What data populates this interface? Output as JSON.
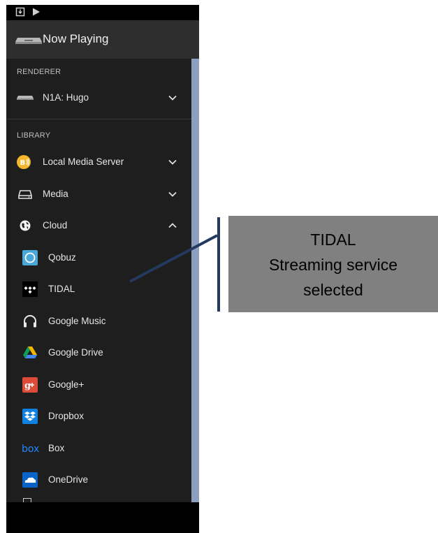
{
  "statusbar": {
    "icons": [
      "download-icon",
      "play-icon"
    ]
  },
  "appbar": {
    "title": "Now Playing",
    "icon": "streamer-device-icon"
  },
  "renderer": {
    "section_label": "RENDERER",
    "device": {
      "label": "N1A: Hugo",
      "icon": "streamer-device-icon",
      "state": "collapsed"
    }
  },
  "library": {
    "section_label": "LIBRARY",
    "items": [
      {
        "label": "Local Media Server",
        "icon": "media-server-icon",
        "state": "collapsed"
      },
      {
        "label": "Media",
        "icon": "hard-drive-icon",
        "state": "collapsed"
      },
      {
        "label": "Cloud",
        "icon": "globe-icon",
        "state": "expanded"
      }
    ],
    "cloud_services": [
      {
        "label": "Qobuz",
        "icon": "qobuz-icon"
      },
      {
        "label": "TIDAL",
        "icon": "tidal-icon"
      },
      {
        "label": "Google Music",
        "icon": "headphones-icon"
      },
      {
        "label": "Google Drive",
        "icon": "google-drive-icon"
      },
      {
        "label": "Google+",
        "icon": "google-plus-icon"
      },
      {
        "label": "Dropbox",
        "icon": "dropbox-icon"
      },
      {
        "label": "Box",
        "icon": "box-icon"
      },
      {
        "label": "OneDrive",
        "icon": "onedrive-icon"
      }
    ]
  },
  "callout": {
    "lines": [
      "TIDAL",
      "Streaming service",
      "selected"
    ],
    "color": "#808080"
  },
  "colors": {
    "drawer_bg": "#1e1e1e",
    "appbar_bg": "#2e2e2e",
    "scrollbar": "#8d9fc0",
    "accent_yellow": "#f4b62a"
  }
}
